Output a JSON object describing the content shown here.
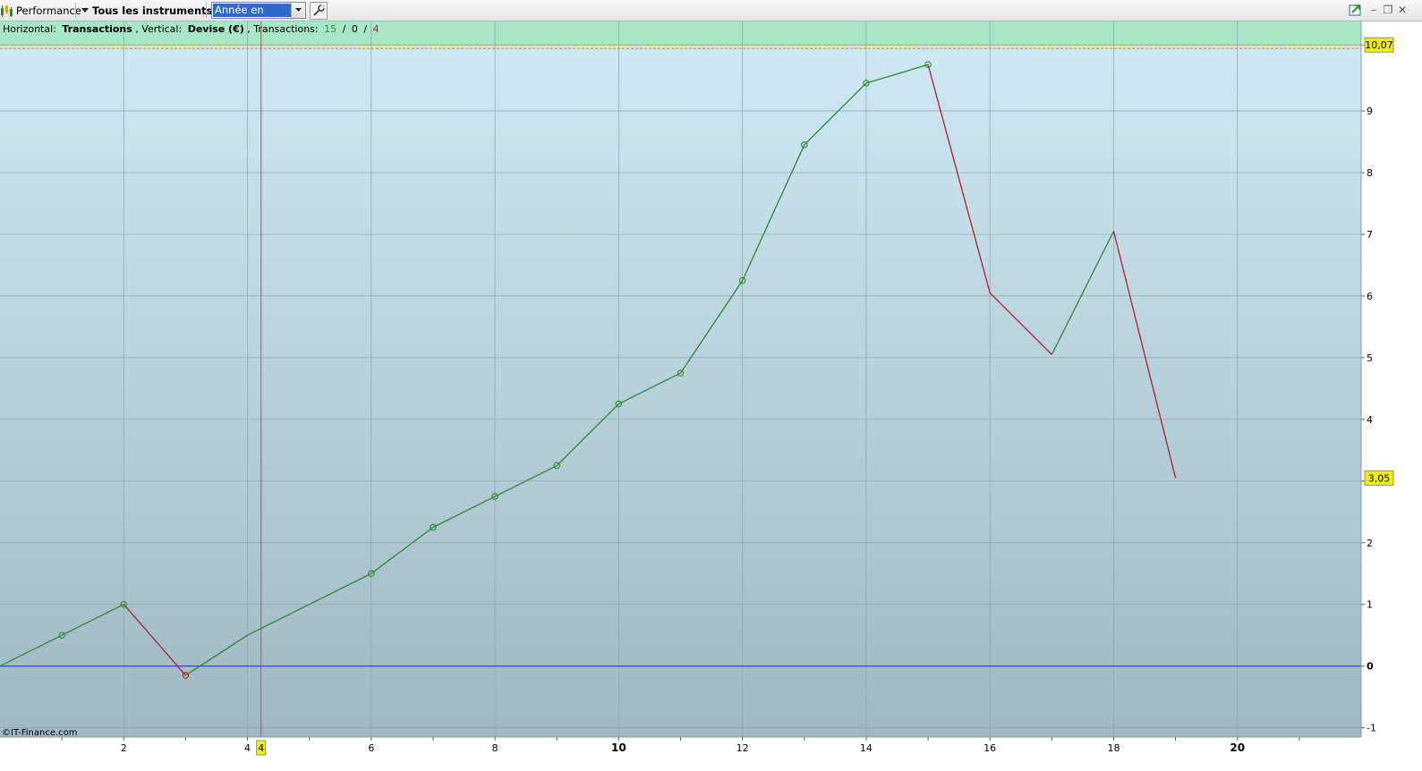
{
  "toolbar": {
    "title": "Performance",
    "instruments_label": "Tous les instruments",
    "period_value": "Année en cours"
  },
  "info": {
    "horizontal_label": "Horizontal:",
    "horizontal_value": "Transactions",
    "vertical_label": ", Vertical:",
    "vertical_value": "Devise (€)",
    "transactions_label": ", Transactions:",
    "winners": "15",
    "neutral": "0",
    "losers": "4",
    "slash": "/"
  },
  "watermark": "©IT-Finance.com",
  "cursor_x_label": "4",
  "colors": {
    "gain": "#2a8a2a",
    "loss": "#b22222",
    "zero_line": "#2020d0",
    "cursor": "#e04040",
    "label_bg": "#f2f200",
    "band": "#a8e6c8"
  },
  "chart_data": {
    "type": "line",
    "xlabel": "",
    "ylabel": "",
    "x": [
      0,
      1,
      2,
      3,
      4,
      5,
      6,
      7,
      8,
      9,
      10,
      11,
      12,
      13,
      14,
      15,
      16,
      17,
      18,
      19
    ],
    "y": [
      0,
      0.5,
      1.0,
      -0.15,
      0.5,
      1.0,
      1.5,
      2.25,
      2.75,
      3.25,
      4.25,
      4.75,
      6.25,
      8.45,
      9.45,
      9.75,
      6.05,
      5.05,
      7.05,
      3.05
    ],
    "xlim": [
      0,
      22
    ],
    "ylim": [
      -1.15,
      10.45
    ],
    "x_ticks": [
      "2",
      "4",
      "6",
      "8",
      "10",
      "12",
      "14",
      "16",
      "18",
      "20"
    ],
    "y_ticks": [
      "-1",
      "0",
      "1",
      "2",
      "3",
      "4",
      "5",
      "6",
      "7",
      "8",
      "9"
    ],
    "max_label": "10,07",
    "max_value": 10.07,
    "last_label": "3,05",
    "last_value": 3.05,
    "cursor_x": 4.22,
    "grid": true
  }
}
